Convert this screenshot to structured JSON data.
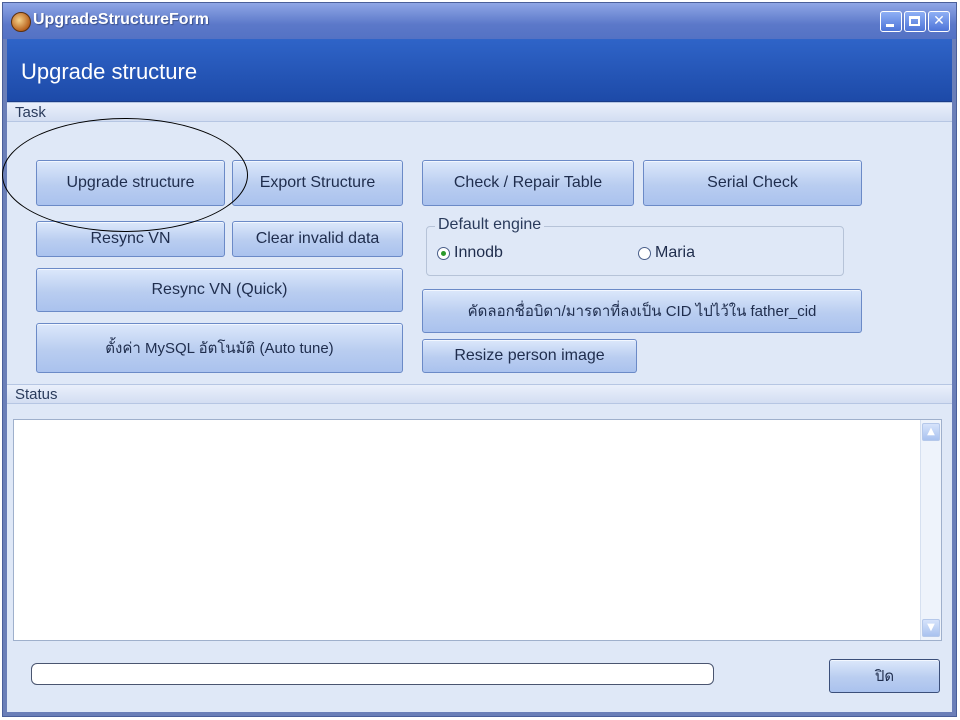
{
  "window": {
    "title": "UpgradeStructureForm"
  },
  "header": {
    "title": "Upgrade structure"
  },
  "task": {
    "label": "Task",
    "buttons": {
      "upgrade_structure": "Upgrade structure",
      "export_structure": "Export Structure",
      "check_repair_table": "Check / Repair Table",
      "serial_check": "Serial Check",
      "resync_vn": "Resync VN",
      "clear_invalid_data": "Clear invalid data",
      "resync_vn_quick": "Resync VN (Quick)",
      "copy_father_cid": "คัดลอกชื่อบิดา/มารดาที่ลงเป็น CID ไปไว้ใน father_cid",
      "mysql_auto_tune": "ตั้งค่า MySQL อัตโนมัติ (Auto tune)",
      "resize_person_image": "Resize person image"
    },
    "default_engine": {
      "label": "Default engine",
      "options": [
        "Innodb",
        "Maria"
      ],
      "selected": "Innodb"
    }
  },
  "status": {
    "label": "Status",
    "text": ""
  },
  "footer": {
    "close_button": "ปิด",
    "progress": 0
  }
}
